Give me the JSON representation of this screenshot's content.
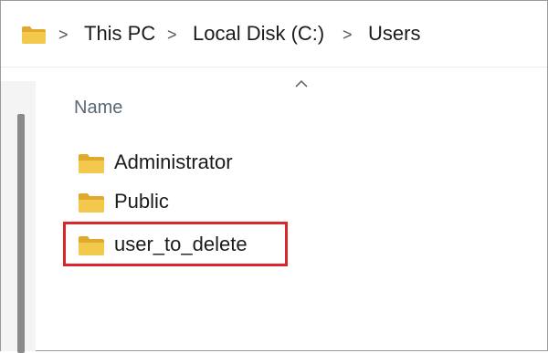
{
  "address_bar": {
    "path": [
      "This PC",
      "Local Disk (C:)",
      "Users"
    ],
    "separator": ">",
    "icon": "folder-icon"
  },
  "file_list": {
    "column_header": "Name",
    "sort_indicator": "^",
    "items": [
      {
        "name": "Administrator",
        "icon": "folder-icon"
      },
      {
        "name": "Public",
        "icon": "folder-icon"
      },
      {
        "name": "user_to_delete",
        "icon": "folder-icon",
        "highlighted": true
      }
    ]
  },
  "colors": {
    "folder": "#f2c94c",
    "folder_dark": "#e0a92b",
    "highlight": "#d9262b"
  }
}
